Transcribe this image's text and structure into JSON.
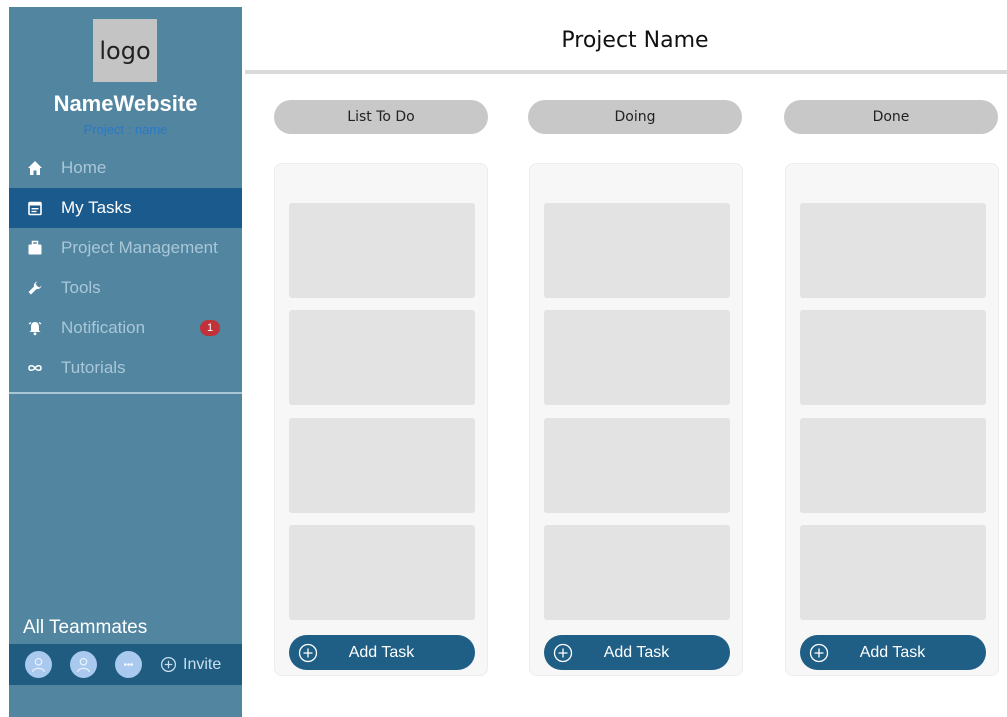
{
  "sidebar": {
    "logo_text": "logo",
    "site_name": "NameWebsite",
    "project_sub": "Project : name",
    "nav": [
      {
        "label": "Home",
        "icon": "home-icon"
      },
      {
        "label": "My Tasks",
        "icon": "calendar-icon",
        "active": true
      },
      {
        "label": "Project Management",
        "icon": "briefcase-icon"
      },
      {
        "label": "Tools",
        "icon": "wrench-icon"
      },
      {
        "label": "Notification",
        "icon": "bell-icon",
        "badge": "1"
      },
      {
        "label": "Tutorials",
        "icon": "infinity-icon"
      }
    ],
    "teammates_title": "All Teammates",
    "invite_label": "Invite"
  },
  "header": {
    "title": "Project Name"
  },
  "board": {
    "columns": [
      {
        "title": "List To Do",
        "add_label": "Add Task"
      },
      {
        "title": "Doing",
        "add_label": "Add Task"
      },
      {
        "title": "Done",
        "add_label": "Add Task"
      }
    ]
  },
  "colors": {
    "sidebar_bg": "#5285a0",
    "active_nav": "#1b5a8c",
    "button": "#1f5f86",
    "badge": "#c0313a"
  }
}
